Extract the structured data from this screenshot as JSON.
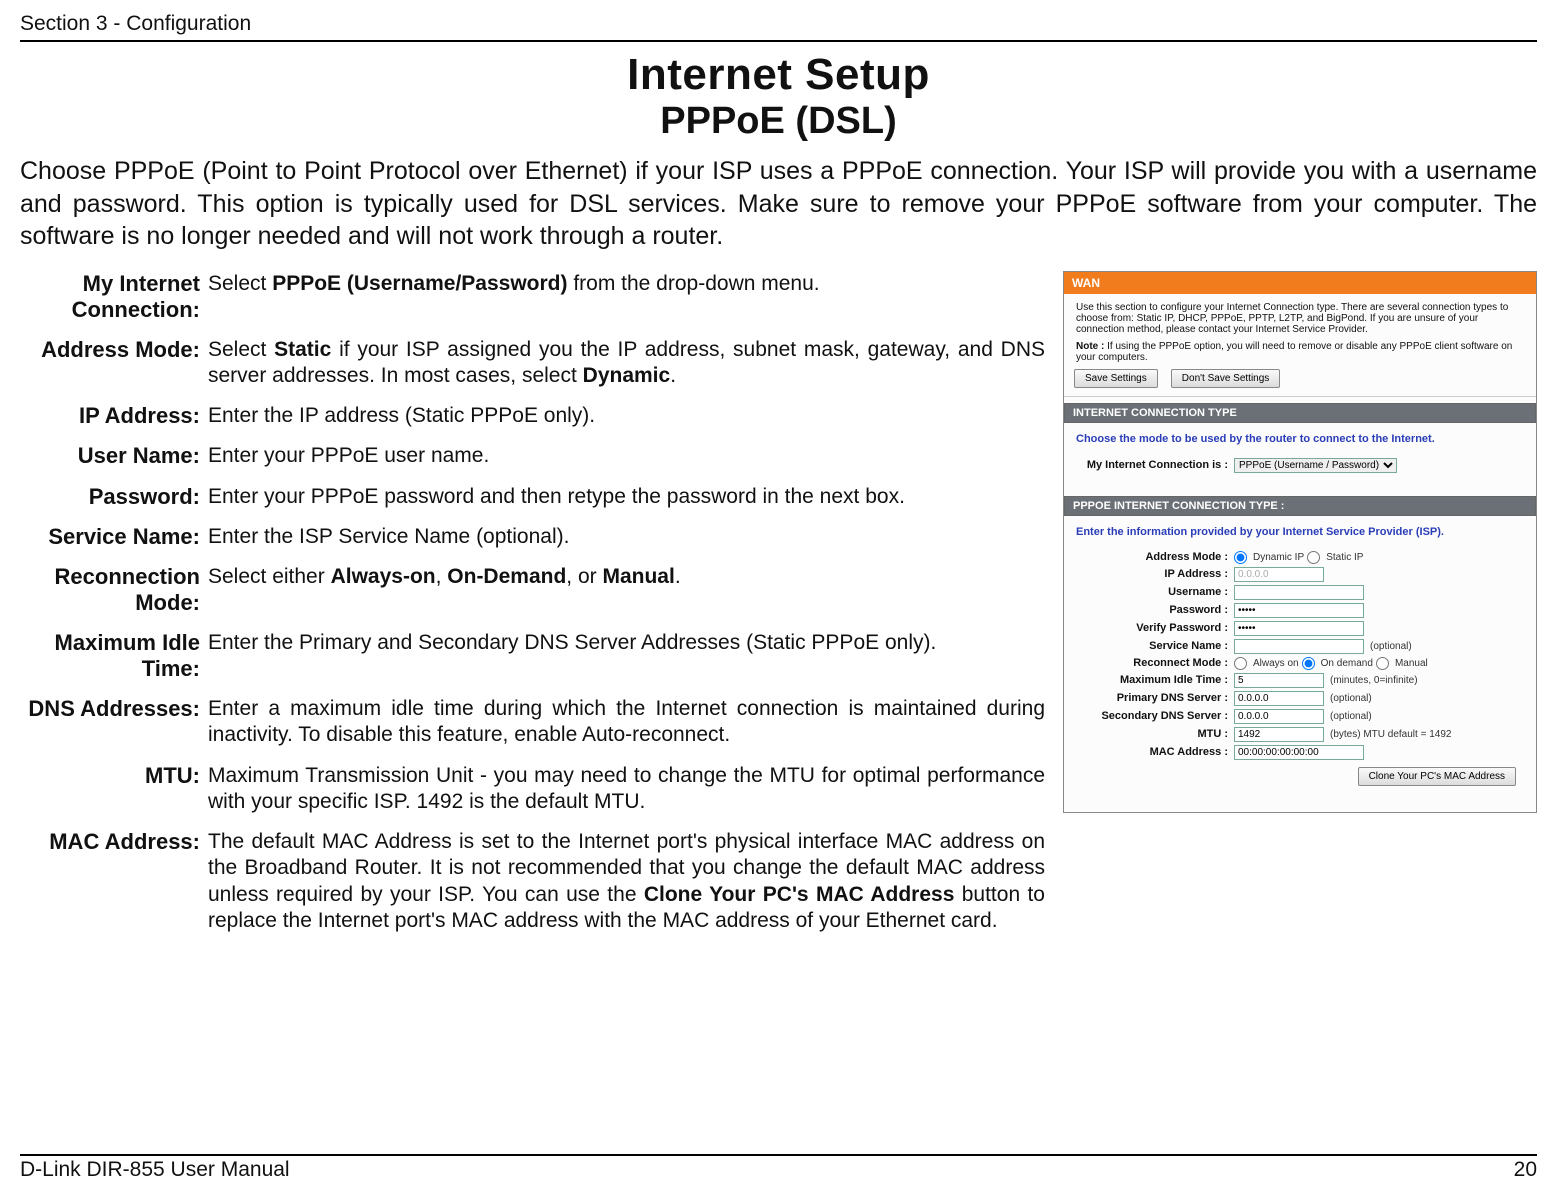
{
  "header": {
    "section": "Section 3 - Configuration"
  },
  "footer": {
    "manual": "D-Link DIR-855 User Manual",
    "page": "20"
  },
  "page_title": "Internet Setup",
  "page_subtitle": "PPPoE (DSL)",
  "intro": "Choose PPPoE (Point to Point Protocol over Ethernet) if your ISP uses a PPPoE connection. Your ISP will provide you with a username and password. This option is typically used for DSL services. Make sure to remove your PPPoE software from your computer. The software is no longer needed and will not work through a router.",
  "descriptions": [
    {
      "label": "My Internet Connection:",
      "pre": "Select ",
      "bold1": "PPPoE (Username/Password)",
      "post": " from the drop-down menu."
    },
    {
      "label": "Address Mode:",
      "text": "Select Static if your ISP assigned you the IP address, subnet mask, gateway, and DNS server addresses. In most cases, select Dynamic."
    },
    {
      "label": "IP Address:",
      "plain": "Enter the IP address (Static PPPoE only)."
    },
    {
      "label": "User Name:",
      "plain": "Enter your PPPoE user name."
    },
    {
      "label": "Password:",
      "plain": "Enter your PPPoE password and then retype the password in the next box."
    },
    {
      "label": "Service Name:",
      "plain": "Enter the ISP Service Name (optional)."
    },
    {
      "label": "Reconnection Mode:",
      "text2": "Select either Always-on, On-Demand, or Manual."
    },
    {
      "label": "Maximum Idle Time:",
      "plain": "Enter the Primary and Secondary DNS Server Addresses (Static PPPoE only)."
    },
    {
      "label": "DNS Addresses:",
      "plain": "Enter a maximum idle time during which the Internet connection is maintained during inactivity. To disable this feature, enable Auto-reconnect."
    },
    {
      "label": "MTU:",
      "plain": "Maximum Transmission Unit - you may need to change the MTU for optimal performance with your specific ISP. 1492 is the default MTU."
    },
    {
      "label": "MAC Address:",
      "text3": "The default MAC Address is set to the Internet port's physical interface MAC address on the Broadband Router. It is not recommended that you change the default MAC address unless required by your ISP.  You can use the Clone Your PC's MAC Address button to replace the Internet port's MAC address with the MAC address of your Ethernet card."
    }
  ],
  "router": {
    "wan_title": "WAN",
    "wan_desc": "Use this section to configure your Internet Connection type. There are several connection types to choose from: Static IP, DHCP, PPPoE, PPTP, L2TP, and BigPond. If you are unsure of your connection method, please contact your Internet Service Provider.",
    "wan_note_label": "Note :",
    "wan_note": " If using the PPPoE option, you will need to remove or disable any PPPoE client software on your computers.",
    "btn_save": "Save Settings",
    "btn_dont": "Don't Save Settings",
    "bar_conn_type": "INTERNET CONNECTION TYPE",
    "blue_conn_type": "Choose the mode to be used by the router to connect to the Internet.",
    "lbl_my_conn": "My Internet Connection is :",
    "sel_conn": "PPPoE (Username / Password)",
    "bar_pppoe": "PPPOE INTERNET CONNECTION TYPE :",
    "blue_pppoe": "Enter the information provided by your Internet Service Provider (ISP).",
    "fields": {
      "address_mode": {
        "label": "Address Mode :",
        "opt1": "Dynamic IP",
        "opt2": "Static IP"
      },
      "ip": {
        "label": "IP Address :",
        "value": "0.0.0.0"
      },
      "user": {
        "label": "Username :",
        "value": ""
      },
      "pass": {
        "label": "Password :",
        "value": "•••••"
      },
      "vpass": {
        "label": "Verify Password :",
        "value": "•••••"
      },
      "service": {
        "label": "Service Name :",
        "value": "",
        "optional": "(optional)"
      },
      "reconnect": {
        "label": "Reconnect Mode :",
        "opt1": "Always on",
        "opt2": "On demand",
        "opt3": "Manual"
      },
      "idle": {
        "label": "Maximum Idle Time :",
        "value": "5",
        "note": "(minutes, 0=infinite)"
      },
      "pdns": {
        "label": "Primary DNS Server :",
        "value": "0.0.0.0",
        "optional": "(optional)"
      },
      "sdns": {
        "label": "Secondary DNS Server :",
        "value": "0.0.0.0",
        "optional": "(optional)"
      },
      "mtu": {
        "label": "MTU :",
        "value": "1492",
        "note": "(bytes) MTU default = 1492"
      },
      "mac": {
        "label": "MAC Address :",
        "value": "00:00:00:00:00:00"
      }
    },
    "btn_clone": "Clone Your PC's MAC Address"
  }
}
